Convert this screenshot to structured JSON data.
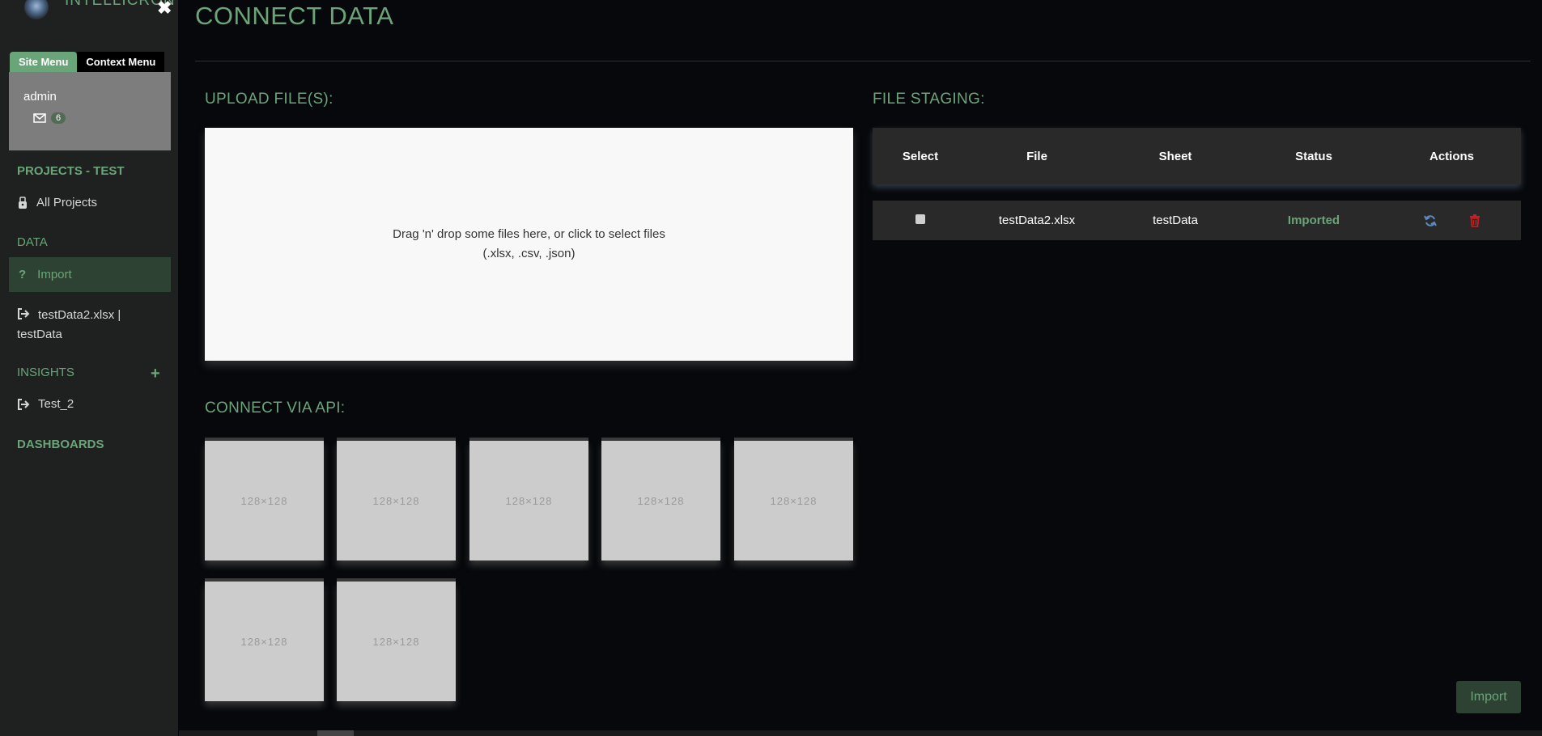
{
  "brand": {
    "name": "INTELLICRON"
  },
  "sidebar": {
    "tabs": [
      {
        "label": "Site Menu"
      },
      {
        "label": "Context Menu"
      }
    ],
    "user": {
      "name": "admin",
      "mail_count": "6"
    },
    "project_heading": "PROJECTS - TEST",
    "all_projects": "All Projects",
    "data_heading": "DATA",
    "import": "Import",
    "file_item_line1": "testData2.xlsx |",
    "file_item_line2": "testData",
    "insights_heading": "INSIGHTS",
    "insight_item": "Test_2",
    "dashboards_heading": "DASHBOARDS"
  },
  "main": {
    "title": "CONNECT DATA",
    "upload_heading": "UPLOAD FILE(S):",
    "dropzone_line1": "Drag 'n' drop some files here, or click to select files",
    "dropzone_line2": "(.xlsx, .csv, .json)",
    "api_heading": "CONNECT VIA API:",
    "api_tiles": [
      {
        "label": "128×128"
      },
      {
        "label": "128×128"
      },
      {
        "label": "128×128"
      },
      {
        "label": "128×128"
      },
      {
        "label": "128×128"
      },
      {
        "label": "128×128"
      },
      {
        "label": "128×128"
      }
    ],
    "staging_heading": "FILE STAGING:",
    "table": {
      "headers": [
        "Select",
        "File",
        "Sheet",
        "Status",
        "Actions"
      ],
      "rows": [
        {
          "file": "testData2.xlsx",
          "sheet": "testData",
          "status": "Imported"
        }
      ]
    },
    "import_button": "Import"
  },
  "colors": {
    "accent": "#6aa57a",
    "danger": "#cc1f1f",
    "refresh": "#5a8ac0"
  }
}
